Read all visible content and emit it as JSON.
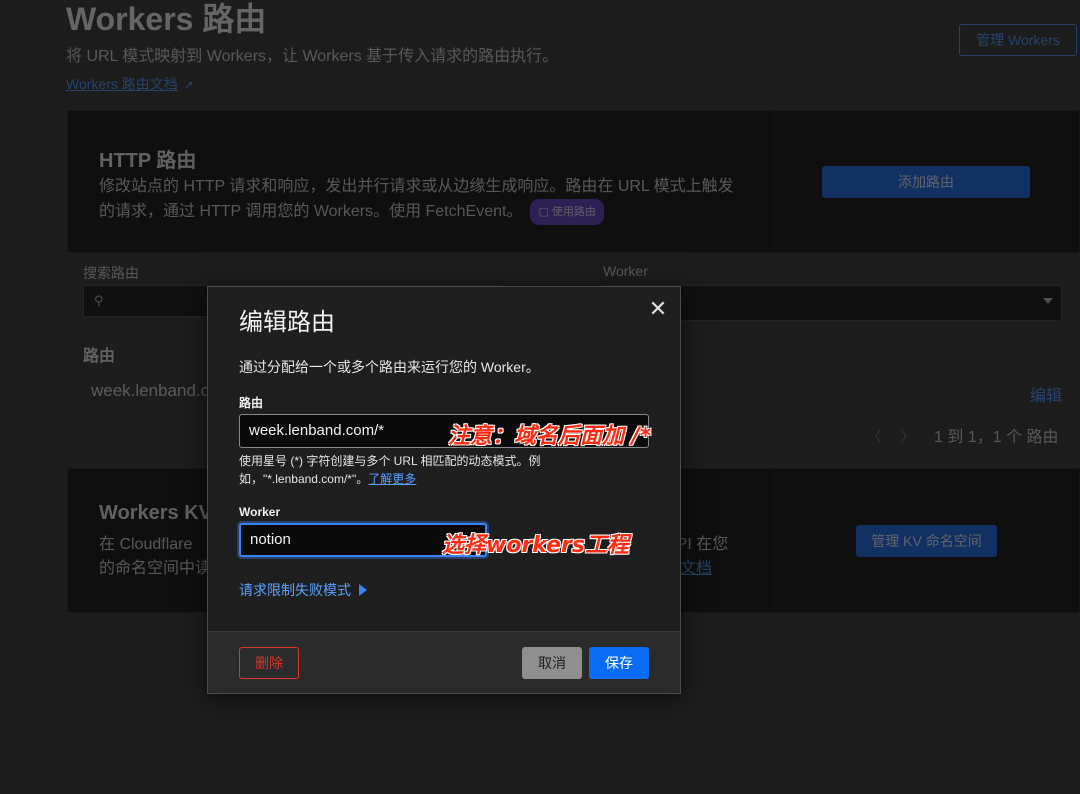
{
  "header": {
    "title": "Workers 路由",
    "subtitle": "将 URL 模式映射到 Workers，让 Workers 基于传入请求的路由执行。",
    "docs_link": "Workers 路由文档",
    "manage_workers": "管理 Workers"
  },
  "http_routes": {
    "title": "HTTP 路由",
    "description": "修改站点的 HTTP 请求和响应，发出并行请求或从边缘生成响应。路由在 URL 模式上触发的请求，通过 HTTP 调用您的 Workers。使用 FetchEvent。",
    "badge": "使用路由",
    "add_button": "添加路由"
  },
  "filters": {
    "search_label": "搜索路由",
    "worker_label": "Worker"
  },
  "routes_list": {
    "heading": "路由",
    "rows": [
      {
        "route": "week.lenband.c",
        "edit": "编辑"
      }
    ],
    "pagination": "1 到 1，1 个 路由"
  },
  "kv": {
    "title": "Workers KV",
    "description_line1": "在 Cloudflare",
    "description_line2": "的命名空间中读",
    "right_fragment_1": "API 在您",
    "right_fragment_2": "文档",
    "manage_button": "管理 KV 命名空间"
  },
  "modal": {
    "title": "编辑路由",
    "description": "通过分配给一个或多个路由来运行您的 Worker。",
    "route_label": "路由",
    "route_value": "week.lenband.com/*",
    "help_text": "使用星号 (*) 字符创建与多个 URL 相匹配的动态模式。例如，\"*.lenband.com/*\"。",
    "learn_more": "了解更多",
    "worker_label": "Worker",
    "worker_value": "notion",
    "advanced_toggle": "请求限制失败模式",
    "delete_button": "删除",
    "cancel_button": "取消",
    "save_button": "保存"
  },
  "annotations": {
    "route_note": "注意：域名后面加 /*",
    "worker_note": "选择workers工程"
  },
  "colors": {
    "accent": "#0a6cf5",
    "danger": "#d9362b",
    "annotation": "#ff2a12"
  }
}
